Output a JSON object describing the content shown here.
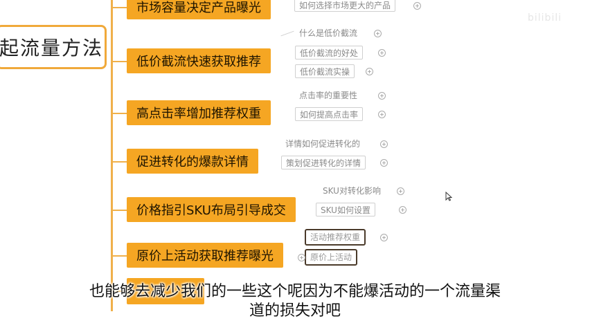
{
  "root": {
    "label": "起流量方法"
  },
  "nodes": [
    {
      "label": "市场容量决定产品曝光",
      "subs": [
        "如何选择市场更大的产品"
      ]
    },
    {
      "label": "低价截流快速获取推荐",
      "subs": [
        "什么是低价截流",
        "低价截流的好处",
        "低价截流实操"
      ]
    },
    {
      "label": "高点击率增加推荐权重",
      "subs": [
        "点击率的重要性",
        "如何提高点击率"
      ]
    },
    {
      "label": "促进转化的爆款详情",
      "subs": [
        "详情如何促进转化的",
        "策划促进转化的详情"
      ]
    },
    {
      "label": "价格指引SKU布局引导成交",
      "subs": [
        "SKU对转化影响",
        "SKU如何设置"
      ]
    },
    {
      "label": "原价上活动获取推荐曝光",
      "subs": [
        "活动推荐权重",
        "原价上活动"
      ]
    }
  ],
  "watermark": "bilibili",
  "subtitle": {
    "line1": "也能够去减少我们的一些这个呢因为不能爆活动的一个流量渠",
    "line2": "道的损失对吧"
  },
  "icons": {
    "expand": "plus-circle-icon",
    "cursor": "mouse-cursor-icon"
  },
  "colors": {
    "node": "#f5a623",
    "connector": "#f0b04a",
    "root_border": "#f0a93a"
  }
}
